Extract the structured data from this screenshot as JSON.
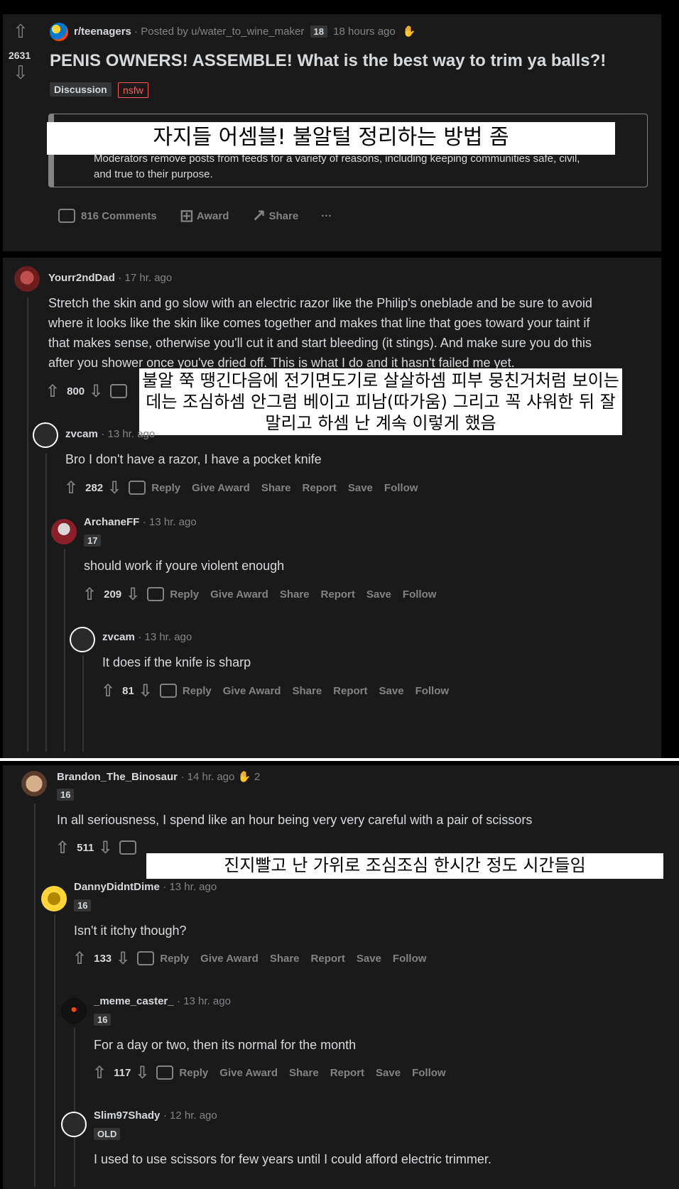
{
  "post": {
    "vote_count": "2631",
    "subreddit": "r/teenagers",
    "posted_by": "Posted by u/water_to_wine_maker",
    "user_flair": "18",
    "time": "18 hours ago",
    "title": "PENIS OWNERS! ASSEMBLE! What is the best way to trim ya balls?!",
    "flair": "Discussion",
    "nsfw_tag": "nsfw",
    "mod_notice_line1": "Moderators remove posts from feeds for a variety of reasons, including keeping communities safe, civil,",
    "mod_notice_line2": "and true to their purpose.",
    "overlay_korean": "자지들 어셈블! 불알털 정리하는 방법 좀",
    "actions": {
      "comments": "816 Comments",
      "award": "Award",
      "share": "Share",
      "more": "···"
    }
  },
  "comments_top": [
    {
      "username": "Yourr2ndDad",
      "time": "· 17 hr. ago",
      "body": "Stretch the skin and go slow with an electric razor like the Philip's oneblade and be sure to avoid where it looks like the skin like comes together and makes that line that goes toward your taint if that makes sense, otherwise you'll cut it and start bleeding (it stings). And make sure you do this after you shower once you've dried off. This is what I do and it hasn't failed me yet.",
      "votes": "800",
      "overlay_korean": "불알 쭉 땡긴다음에 전기면도기로 살살하셈 피부 뭉친거처럼 보이는데는 조심하셈 안그럼 베이고 피남(따가움) 그리고 꼭 샤워한 뒤 잘 말리고 하셈 난 계속 이렇게 했음"
    },
    {
      "username": "zvcam",
      "time": "· 13 hr. ago",
      "body": "Bro I don't have a razor, I have a pocket knife",
      "votes": "282"
    },
    {
      "username": "ArchaneFF",
      "time": "· 13 hr. ago",
      "flair": "17",
      "body": "should work if youre violent enough",
      "votes": "209"
    },
    {
      "username": "zvcam",
      "time": "· 13 hr. ago",
      "body": "It does if the knife is sharp",
      "votes": "81"
    }
  ],
  "comments_bottom": [
    {
      "username": "Brandon_The_Binosaur",
      "time": "· 14 hr. ago",
      "award_count": "2",
      "flair": "16",
      "body": "In all seriousness, I spend like an hour being very very careful with a pair of scissors",
      "votes": "511",
      "overlay_korean": "진지빨고 난 가위로 조심조심 한시간 정도 시간들임"
    },
    {
      "username": "DannyDidntDime",
      "time": "· 13 hr. ago",
      "flair": "16",
      "body": "Isn't it itchy though?",
      "votes": "133"
    },
    {
      "username": "_meme_caster_",
      "time": "· 13 hr. ago",
      "flair": "16",
      "body": "For a day or two, then its normal for the month",
      "votes": "117"
    },
    {
      "username": "Slim97Shady",
      "time": "· 12 hr. ago",
      "flair": "OLD",
      "body": "I used to use scissors for few years until I could afford electric trimmer."
    }
  ],
  "actions": {
    "reply": "Reply",
    "give_award": "Give Award",
    "share": "Share",
    "report": "Report",
    "save": "Save",
    "follow": "Follow"
  }
}
